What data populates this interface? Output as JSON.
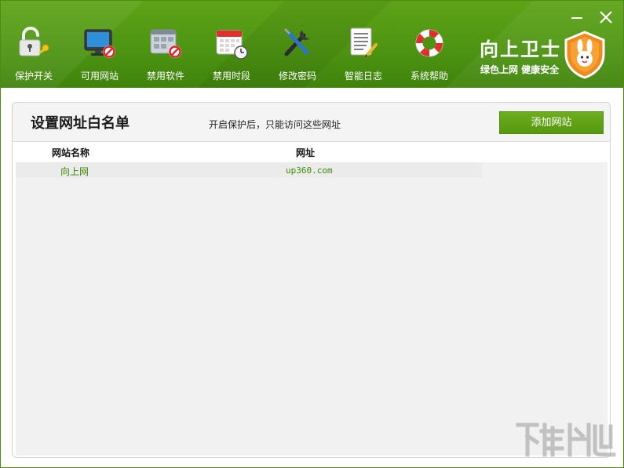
{
  "toolbar": {
    "items": [
      {
        "label": "保护开关",
        "icon": "unlocked-padlock-key-icon"
      },
      {
        "label": "可用网站",
        "icon": "monitor-block-icon"
      },
      {
        "label": "禁用软件",
        "icon": "app-window-block-icon"
      },
      {
        "label": "禁用时段",
        "icon": "calendar-clock-icon"
      },
      {
        "label": "修改密码",
        "icon": "wrench-screwdriver-icon"
      },
      {
        "label": "智能日志",
        "icon": "document-pencil-icon"
      },
      {
        "label": "系统帮助",
        "icon": "lifebuoy-icon"
      }
    ]
  },
  "brand": {
    "name": "向上卫士",
    "slogan": "绿色上网 健康安全",
    "logo_icon": "rabbit-shield-icon"
  },
  "window_controls": {
    "minimize_icon": "minimize-icon",
    "close_icon": "close-icon"
  },
  "panel": {
    "title": "设置网址白名单",
    "description": "开启保护后，只能访问这些网址",
    "add_button": "添加网站"
  },
  "table": {
    "columns": [
      "网站名称",
      "网址"
    ],
    "rows": [
      {
        "name": "向上网",
        "url": "up360.com"
      }
    ]
  },
  "colors": {
    "header_green": "#4c9312",
    "accent_green": "#56980f",
    "link_green": "#3d8b00",
    "shield_orange": "#f08a1c"
  }
}
